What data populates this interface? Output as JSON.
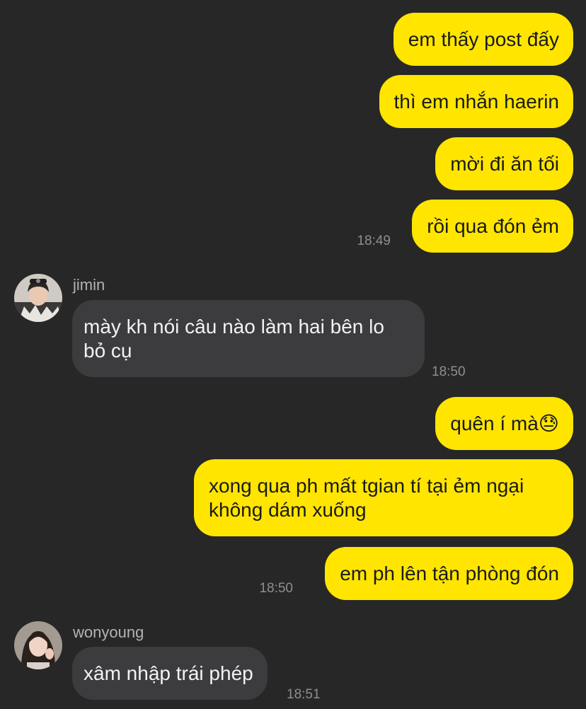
{
  "messages": [
    {
      "text": "em thấy post đấy"
    },
    {
      "text": "thì em nhắn haerin"
    },
    {
      "text": "mời đi ăn tối"
    },
    {
      "text": "rồi qua đón ẻm",
      "time": "18:49"
    },
    {
      "sender": "jimin",
      "avatar_icon": "jimin-avatar-photo",
      "text": "mày kh nói câu nào làm hai bên lo bỏ cụ",
      "time": "18:50"
    },
    {
      "text": "quên í mà",
      "emoji": "😓"
    },
    {
      "text": "xong qua ph mất tgian tí tại ẻm ngại không dám xuống"
    },
    {
      "text": "em ph lên tận phòng đón",
      "time": "18:50"
    },
    {
      "sender": "wonyoung",
      "avatar_icon": "wonyoung-avatar-photo",
      "text": "xâm nhập trái phép",
      "time": "18:51"
    }
  ],
  "colors": {
    "background": "#272727",
    "outgoing_bubble": "#FFE500",
    "incoming_bubble": "#3c3c3e",
    "timestamp": "#8e8e93"
  }
}
